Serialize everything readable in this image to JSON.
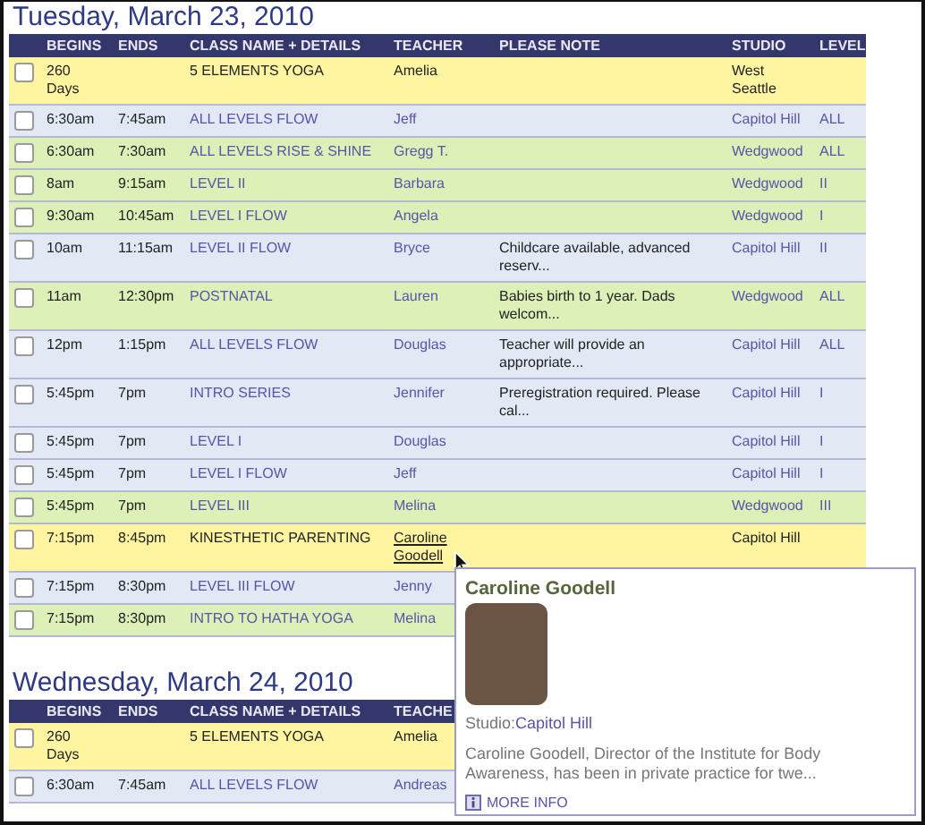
{
  "days": [
    {
      "heading": "Tuesday, March 23, 2010",
      "columns": [
        "BEGINS",
        "ENDS",
        "CLASS NAME + DETAILS",
        "TEACHER",
        "PLEASE NOTE",
        "STUDIO",
        "LEVEL"
      ],
      "rows": [
        {
          "kind": "featured",
          "color": "#fff5a0",
          "checked": false,
          "hovered": false,
          "begins": "260 Days",
          "class_name": "5 ELEMENTS YOGA",
          "teacher": "Amelia",
          "studio": "West Seattle"
        },
        {
          "kind": "regular",
          "color": "#e2e9f5",
          "checked": false,
          "hovered": false,
          "begins": "6:30am",
          "ends": "7:45am",
          "class_name": "ALL LEVELS FLOW",
          "teacher": "Jeff",
          "studio": "Capitol Hill",
          "level": "ALL"
        },
        {
          "kind": "regular",
          "color": "#ddf0b8",
          "checked": false,
          "hovered": false,
          "begins": "6:30am",
          "ends": "7:30am",
          "class_name": "ALL LEVELS RISE & SHINE",
          "teacher": "Gregg T.",
          "studio": "Wedgwood",
          "level": "ALL"
        },
        {
          "kind": "regular",
          "color": "#ddf0b8",
          "checked": false,
          "hovered": false,
          "begins": "8am",
          "ends": "9:15am",
          "class_name": "LEVEL II",
          "teacher": "Barbara",
          "studio": "Wedgwood",
          "level": "II"
        },
        {
          "kind": "regular",
          "color": "#ddf0b8",
          "checked": false,
          "hovered": false,
          "begins": "9:30am",
          "ends": "10:45am",
          "class_name": "LEVEL I FLOW",
          "teacher": "Angela",
          "studio": "Wedgwood",
          "level": "I"
        },
        {
          "kind": "regular",
          "color": "#e2e9f5",
          "checked": false,
          "hovered": false,
          "begins": "10am",
          "ends": "11:15am",
          "class_name": "LEVEL II FLOW",
          "teacher": "Bryce",
          "note": "Childcare available, advanced reserv...",
          "studio": "Capitol Hill",
          "level": "II"
        },
        {
          "kind": "regular",
          "color": "#ddf0b8",
          "checked": false,
          "hovered": false,
          "begins": "11am",
          "ends": "12:30pm",
          "class_name": "POSTNATAL",
          "teacher": "Lauren",
          "note": "Babies birth to 1 year. Dads welcom...",
          "studio": "Wedgwood",
          "level": "ALL"
        },
        {
          "kind": "regular",
          "color": "#e2e9f5",
          "checked": false,
          "hovered": false,
          "begins": "12pm",
          "ends": "1:15pm",
          "class_name": "ALL LEVELS FLOW",
          "teacher": "Douglas",
          "note": "Teacher will provide an appropriate...",
          "studio": "Capitol Hill",
          "level": "ALL"
        },
        {
          "kind": "regular",
          "color": "#e2e9f5",
          "checked": false,
          "hovered": false,
          "begins": "5:45pm",
          "ends": "7pm",
          "class_name": "INTRO SERIES",
          "teacher": "Jennifer",
          "note": "Preregistration required. Please cal...",
          "studio": "Capitol Hill",
          "level": "I"
        },
        {
          "kind": "regular",
          "color": "#e2e9f5",
          "checked": false,
          "hovered": false,
          "begins": "5:45pm",
          "ends": "7pm",
          "class_name": "LEVEL I",
          "teacher": "Douglas",
          "studio": "Capitol Hill",
          "level": "I"
        },
        {
          "kind": "regular",
          "color": "#e2e9f5",
          "checked": false,
          "hovered": false,
          "begins": "5:45pm",
          "ends": "7pm",
          "class_name": "LEVEL I FLOW",
          "teacher": "Jeff",
          "studio": "Capitol Hill",
          "level": "I"
        },
        {
          "kind": "regular",
          "color": "#ddf0b8",
          "checked": false,
          "hovered": false,
          "begins": "5:45pm",
          "ends": "7pm",
          "class_name": "LEVEL III",
          "teacher": "Melina",
          "studio": "Wedgwood",
          "level": "III"
        },
        {
          "kind": "featured",
          "color": "#fff5a0",
          "checked": false,
          "hovered": true,
          "begins": "7:15pm",
          "ends": "8:45pm",
          "class_name": "KINESTHETIC PARENTING",
          "teacher": "Caroline Goodell",
          "studio": "Capitol Hill"
        },
        {
          "kind": "regular",
          "color": "#e2e9f5",
          "checked": false,
          "hovered": false,
          "begins": "7:15pm",
          "ends": "8:30pm",
          "class_name": "LEVEL III FLOW",
          "teacher": "Jenny"
        },
        {
          "kind": "regular",
          "color": "#ddf0b8",
          "checked": false,
          "hovered": false,
          "begins": "7:15pm",
          "ends": "8:30pm",
          "class_name": "INTRO TO HATHA YOGA",
          "teacher": "Melina"
        }
      ]
    },
    {
      "heading": "Wednesday, March 24, 2010",
      "columns": [
        "BEGINS",
        "ENDS",
        "CLASS NAME + DETAILS",
        "TEACHE"
      ],
      "rows": [
        {
          "kind": "featured",
          "color": "#fff5a0",
          "checked": false,
          "hovered": false,
          "begins": "260 Days",
          "class_name": "5 ELEMENTS YOGA",
          "teacher": "Amelia"
        },
        {
          "kind": "regular",
          "color": "#e2e9f5",
          "checked": false,
          "hovered": false,
          "begins": "6:30am",
          "ends": "7:45am",
          "class_name": "ALL LEVELS FLOW",
          "teacher": "Andreas"
        }
      ]
    }
  ],
  "popup": {
    "name": "Caroline Goodell",
    "studio_label": "Studio:",
    "studio": "Capitol Hill",
    "bio": "Caroline Goodell, Director of the Institute for Body Awareness, has been in private practice for twe...",
    "more_info": "MORE INFO"
  }
}
